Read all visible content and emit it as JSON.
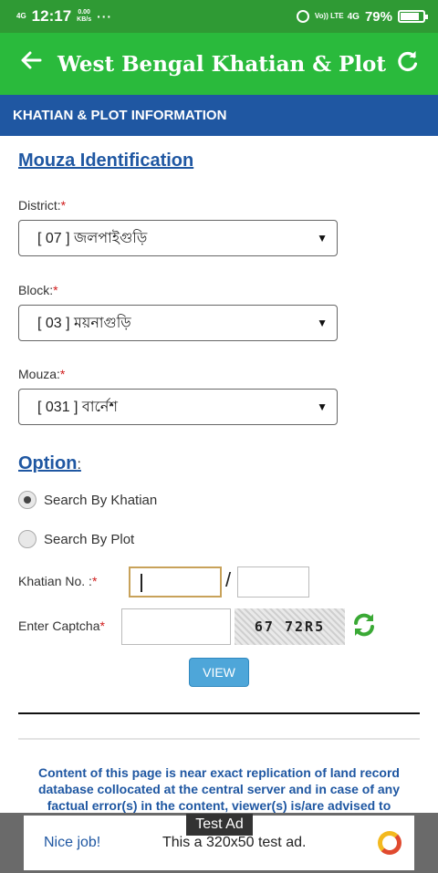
{
  "status_bar": {
    "signal": "4G",
    "time": "12:17",
    "speed_value": "0.00",
    "speed_unit": "KB/s",
    "more": "···",
    "network": "Vo)) LTE",
    "network_type": "4G",
    "battery": "79%"
  },
  "app_bar": {
    "title": "West Bengal Khatian & Plot"
  },
  "section": {
    "title": "KHATIAN & PLOT INFORMATION"
  },
  "form": {
    "heading": "Mouza Identification",
    "district_label": "District:",
    "district_value": "[ 07 ] জলপাইগুড়ি",
    "block_label": "Block:",
    "block_value": "[ 03 ] ময়নাগুড়ি",
    "mouza_label": "Mouza:",
    "mouza_value": "[ 031 ] বার্নেশ",
    "required_mark": "*",
    "option_heading": "Option",
    "option_colon": ":",
    "radio_khatian": "Search By Khatian",
    "radio_plot": "Search By Plot",
    "khatian_label": "Khatian No. :",
    "khatian_value": "",
    "slash": "/",
    "captcha_label": "Enter Captcha",
    "captcha_text": "67 72R5",
    "view_button": "VIEW"
  },
  "notice": {
    "text": "Content of this page is near exact replication of land record database collocated at the central server and in case of any factual error(s) in the content, viewer(s) is/are advised to"
  },
  "ad": {
    "label": "Test Ad",
    "nice": "Nice job!",
    "text": "This a 320x50 test ad."
  }
}
